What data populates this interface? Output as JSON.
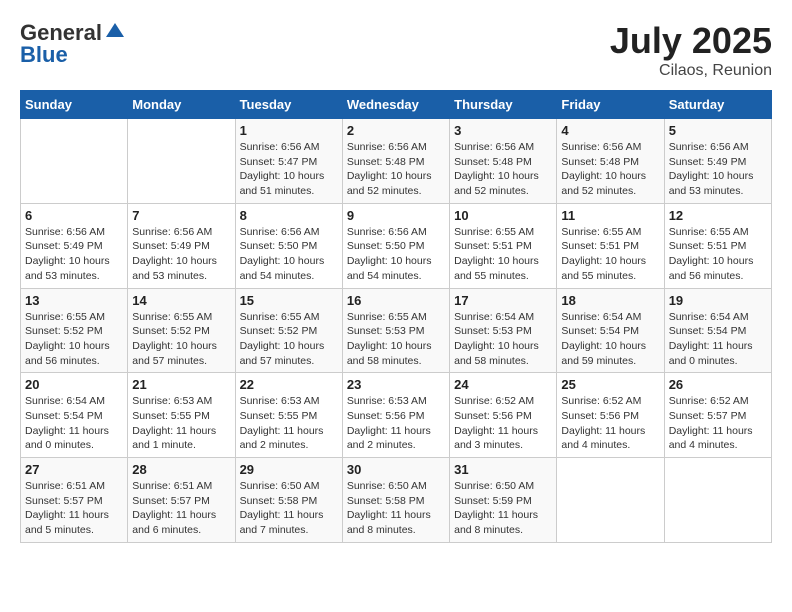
{
  "header": {
    "logo_line1": "General",
    "logo_line2": "Blue",
    "month_year": "July 2025",
    "location": "Cilaos, Reunion"
  },
  "weekdays": [
    "Sunday",
    "Monday",
    "Tuesday",
    "Wednesday",
    "Thursday",
    "Friday",
    "Saturday"
  ],
  "weeks": [
    [
      {
        "day": "",
        "info": ""
      },
      {
        "day": "",
        "info": ""
      },
      {
        "day": "1",
        "info": "Sunrise: 6:56 AM\nSunset: 5:47 PM\nDaylight: 10 hours\nand 51 minutes."
      },
      {
        "day": "2",
        "info": "Sunrise: 6:56 AM\nSunset: 5:48 PM\nDaylight: 10 hours\nand 52 minutes."
      },
      {
        "day": "3",
        "info": "Sunrise: 6:56 AM\nSunset: 5:48 PM\nDaylight: 10 hours\nand 52 minutes."
      },
      {
        "day": "4",
        "info": "Sunrise: 6:56 AM\nSunset: 5:48 PM\nDaylight: 10 hours\nand 52 minutes."
      },
      {
        "day": "5",
        "info": "Sunrise: 6:56 AM\nSunset: 5:49 PM\nDaylight: 10 hours\nand 53 minutes."
      }
    ],
    [
      {
        "day": "6",
        "info": "Sunrise: 6:56 AM\nSunset: 5:49 PM\nDaylight: 10 hours\nand 53 minutes."
      },
      {
        "day": "7",
        "info": "Sunrise: 6:56 AM\nSunset: 5:49 PM\nDaylight: 10 hours\nand 53 minutes."
      },
      {
        "day": "8",
        "info": "Sunrise: 6:56 AM\nSunset: 5:50 PM\nDaylight: 10 hours\nand 54 minutes."
      },
      {
        "day": "9",
        "info": "Sunrise: 6:56 AM\nSunset: 5:50 PM\nDaylight: 10 hours\nand 54 minutes."
      },
      {
        "day": "10",
        "info": "Sunrise: 6:55 AM\nSunset: 5:51 PM\nDaylight: 10 hours\nand 55 minutes."
      },
      {
        "day": "11",
        "info": "Sunrise: 6:55 AM\nSunset: 5:51 PM\nDaylight: 10 hours\nand 55 minutes."
      },
      {
        "day": "12",
        "info": "Sunrise: 6:55 AM\nSunset: 5:51 PM\nDaylight: 10 hours\nand 56 minutes."
      }
    ],
    [
      {
        "day": "13",
        "info": "Sunrise: 6:55 AM\nSunset: 5:52 PM\nDaylight: 10 hours\nand 56 minutes."
      },
      {
        "day": "14",
        "info": "Sunrise: 6:55 AM\nSunset: 5:52 PM\nDaylight: 10 hours\nand 57 minutes."
      },
      {
        "day": "15",
        "info": "Sunrise: 6:55 AM\nSunset: 5:52 PM\nDaylight: 10 hours\nand 57 minutes."
      },
      {
        "day": "16",
        "info": "Sunrise: 6:55 AM\nSunset: 5:53 PM\nDaylight: 10 hours\nand 58 minutes."
      },
      {
        "day": "17",
        "info": "Sunrise: 6:54 AM\nSunset: 5:53 PM\nDaylight: 10 hours\nand 58 minutes."
      },
      {
        "day": "18",
        "info": "Sunrise: 6:54 AM\nSunset: 5:54 PM\nDaylight: 10 hours\nand 59 minutes."
      },
      {
        "day": "19",
        "info": "Sunrise: 6:54 AM\nSunset: 5:54 PM\nDaylight: 11 hours\nand 0 minutes."
      }
    ],
    [
      {
        "day": "20",
        "info": "Sunrise: 6:54 AM\nSunset: 5:54 PM\nDaylight: 11 hours\nand 0 minutes."
      },
      {
        "day": "21",
        "info": "Sunrise: 6:53 AM\nSunset: 5:55 PM\nDaylight: 11 hours\nand 1 minute."
      },
      {
        "day": "22",
        "info": "Sunrise: 6:53 AM\nSunset: 5:55 PM\nDaylight: 11 hours\nand 2 minutes."
      },
      {
        "day": "23",
        "info": "Sunrise: 6:53 AM\nSunset: 5:56 PM\nDaylight: 11 hours\nand 2 minutes."
      },
      {
        "day": "24",
        "info": "Sunrise: 6:52 AM\nSunset: 5:56 PM\nDaylight: 11 hours\nand 3 minutes."
      },
      {
        "day": "25",
        "info": "Sunrise: 6:52 AM\nSunset: 5:56 PM\nDaylight: 11 hours\nand 4 minutes."
      },
      {
        "day": "26",
        "info": "Sunrise: 6:52 AM\nSunset: 5:57 PM\nDaylight: 11 hours\nand 4 minutes."
      }
    ],
    [
      {
        "day": "27",
        "info": "Sunrise: 6:51 AM\nSunset: 5:57 PM\nDaylight: 11 hours\nand 5 minutes."
      },
      {
        "day": "28",
        "info": "Sunrise: 6:51 AM\nSunset: 5:57 PM\nDaylight: 11 hours\nand 6 minutes."
      },
      {
        "day": "29",
        "info": "Sunrise: 6:50 AM\nSunset: 5:58 PM\nDaylight: 11 hours\nand 7 minutes."
      },
      {
        "day": "30",
        "info": "Sunrise: 6:50 AM\nSunset: 5:58 PM\nDaylight: 11 hours\nand 8 minutes."
      },
      {
        "day": "31",
        "info": "Sunrise: 6:50 AM\nSunset: 5:59 PM\nDaylight: 11 hours\nand 8 minutes."
      },
      {
        "day": "",
        "info": ""
      },
      {
        "day": "",
        "info": ""
      }
    ]
  ]
}
